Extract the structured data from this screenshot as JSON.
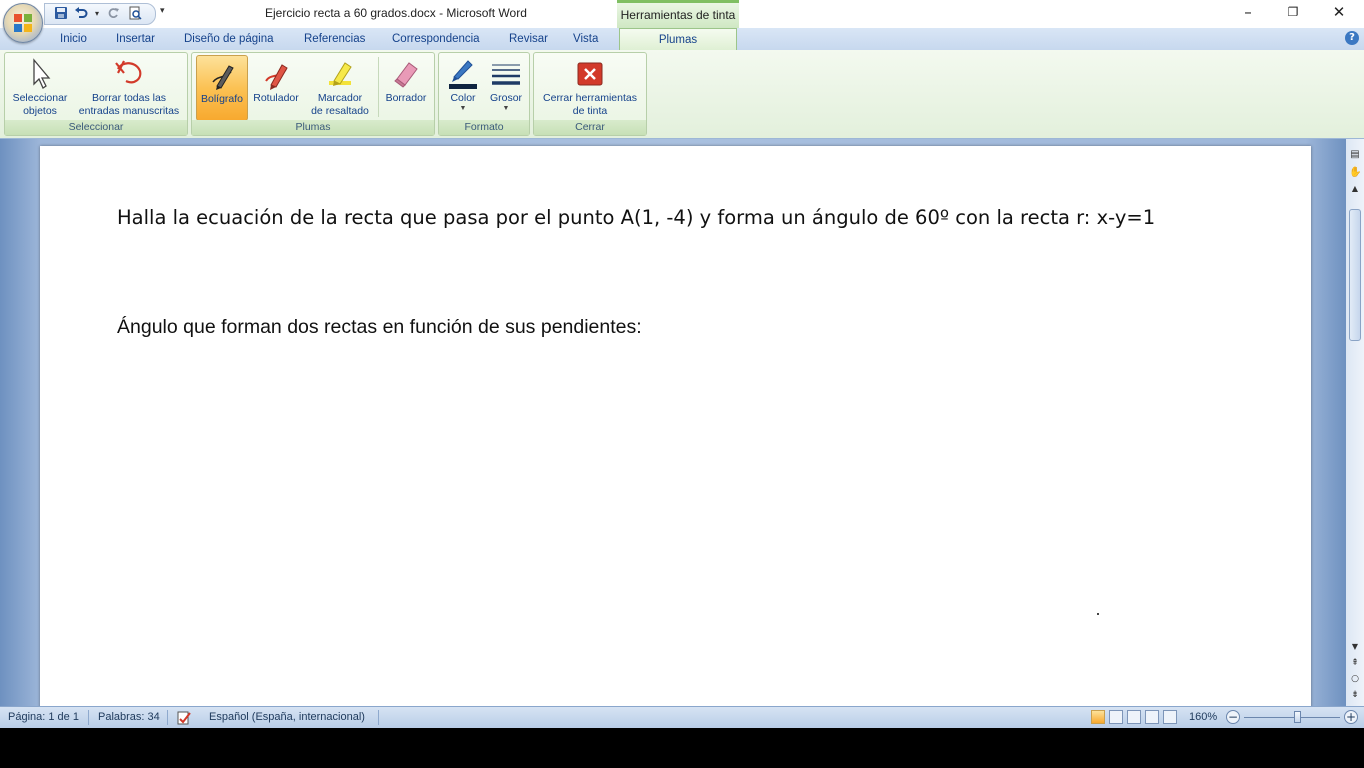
{
  "window": {
    "title": "Ejercicio recta a 60 grados.docx - Microsoft Word",
    "context_tab_group": "Herramientas de tinta",
    "controls": {
      "minimize": "–",
      "restore": "❐",
      "close": "✕"
    }
  },
  "quick_access": {
    "icons": [
      "save-icon",
      "undo-icon",
      "redo-icon",
      "print-preview-icon"
    ]
  },
  "tabs": [
    {
      "label": "Inicio"
    },
    {
      "label": "Insertar"
    },
    {
      "label": "Diseño de página"
    },
    {
      "label": "Referencias"
    },
    {
      "label": "Correspondencia"
    },
    {
      "label": "Revisar"
    },
    {
      "label": "Vista"
    },
    {
      "label": "Plumas",
      "active": true
    }
  ],
  "ribbon": {
    "groups": {
      "seleccionar": "Seleccionar",
      "plumas": "Plumas",
      "formato": "Formato",
      "cerrar": "Cerrar"
    },
    "buttons": {
      "select_objects": "Seleccionar\nobjetos",
      "erase_all": "Borrar todas las\nentradas manuscritas",
      "ballpoint": "Bolígrafo",
      "felt_tip": "Rotulador",
      "highlighter": "Marcador\nde resaltado",
      "eraser": "Borrador",
      "color": "Color",
      "weight": "Grosor",
      "close_ink": "Cerrar herramientas\nde tinta"
    },
    "selected_pen": "Bolígrafo"
  },
  "document": {
    "line1": "Halla la ecuación de la recta que pasa por el punto A(1, -4) y forma un ángulo de 60º con la recta r: x-y=1",
    "line2": "Ángulo que forman dos rectas en función de sus pendientes:"
  },
  "status_bar": {
    "page": "Página: 1 de 1",
    "words": "Palabras: 34",
    "language": "Español (España, internacional)",
    "zoom": "160%",
    "zoom_out": "−",
    "zoom_in": "+"
  },
  "colors": {
    "ribbon_bg": "#e3f0dc",
    "tab_text": "#15428b",
    "status_bg": "#c8d9ee",
    "doc_bg": "#a9c0df",
    "selected_button": "#fbc254"
  }
}
